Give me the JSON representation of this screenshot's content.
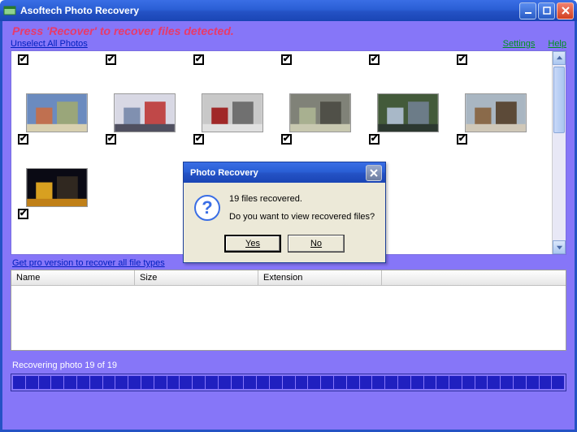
{
  "title": "Asoftech Photo Recovery",
  "instruction": "Press 'Recover' to recover files detected.",
  "links": {
    "unselect": "Unselect All Photos",
    "settings": "Settings",
    "help": "Help"
  },
  "pro_link": "Get pro version to recover all file types",
  "table": {
    "headers": {
      "name": "Name",
      "size": "Size",
      "ext": "Extension"
    }
  },
  "status": "Recovering photo 19 of 19",
  "dialog": {
    "title": "Photo Recovery",
    "line1": "19 files recovered.",
    "line2": "Do you want to view recovered files?",
    "yes": "Yes",
    "no": "No"
  },
  "photos_row1_count": 6,
  "photos_row2_count": 6,
  "photos_row3_count": 1,
  "progress_segments": 43
}
